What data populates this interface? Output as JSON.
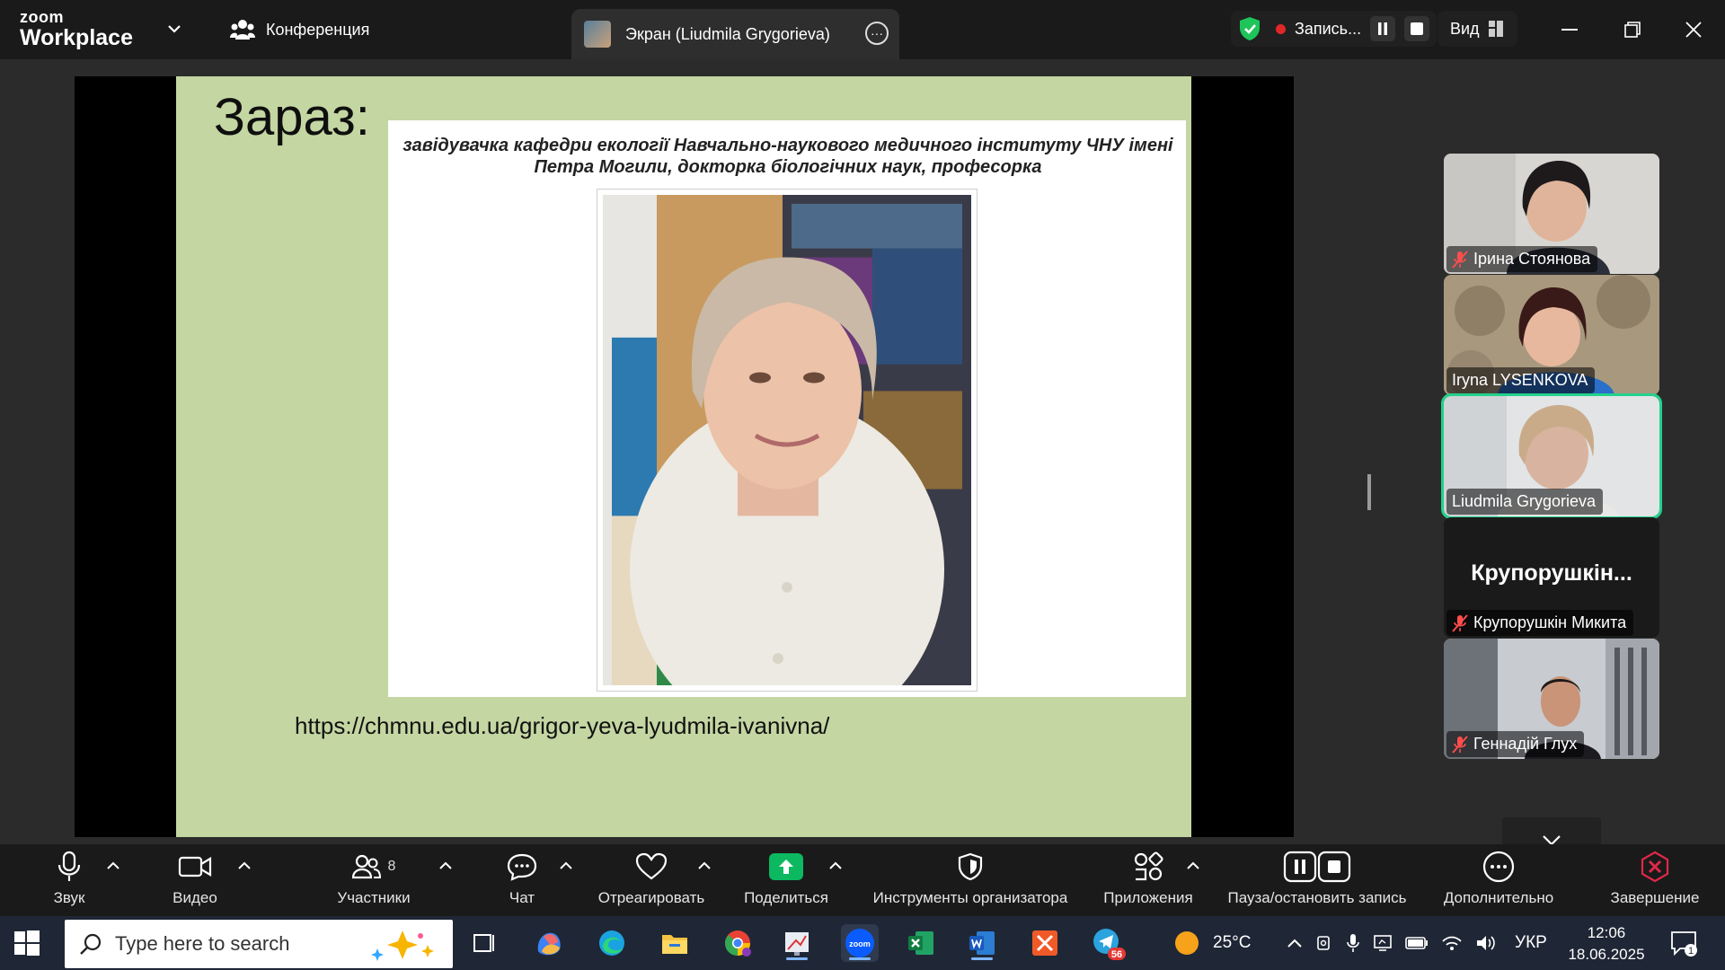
{
  "topbar": {
    "logo_top": "zoom",
    "logo_bottom": "Workplace",
    "tab_conference": "Конференция",
    "tab_screen": "Экран (Liudmila Grygorieva)",
    "recording_label": "Запись...",
    "view_label": "Вид"
  },
  "slide": {
    "title": "Зараз:",
    "caption": "завідувачка кафедри екології Навчально-наукового медичного інституту ЧНУ імені Петра Могили, докторка біологічних наук, професорка",
    "url": "https://chmnu.edu.ua/grigor-yeva-lyudmila-ivanivna/"
  },
  "participants": [
    {
      "name": "Ірина Стоянова",
      "muted": true
    },
    {
      "name": "Iryna LYSENKOVA",
      "muted": false
    },
    {
      "name": "Liudmila Grygorieva",
      "muted": false,
      "active": true
    },
    {
      "name": "Крупорушкін Микита",
      "muted": true,
      "display": "Крупорушкін..."
    },
    {
      "name": "Геннадій Глух",
      "muted": true
    }
  ],
  "toolbar": {
    "audio": "Звук",
    "video": "Видео",
    "participants": "Участники",
    "participants_count": "8",
    "chat": "Чат",
    "react": "Отреагировать",
    "share": "Поделиться",
    "host_tools": "Инструменты организатора",
    "apps": "Приложения",
    "record": "Пауза/остановить запись",
    "more": "Дополнительно",
    "end": "Завершение"
  },
  "taskbar": {
    "search_placeholder": "Type here to search",
    "weather": "25°C",
    "language": "УКР",
    "time": "12:06",
    "date": "18.06.2025",
    "telegram_badge": "56",
    "notifications_badge": "1"
  },
  "colors": {
    "slide_bg": "#c4d6a2",
    "active_speaker": "#23d18b",
    "share_green": "#0cb860",
    "end_red": "#e0284a",
    "record_red": "#e02828"
  }
}
